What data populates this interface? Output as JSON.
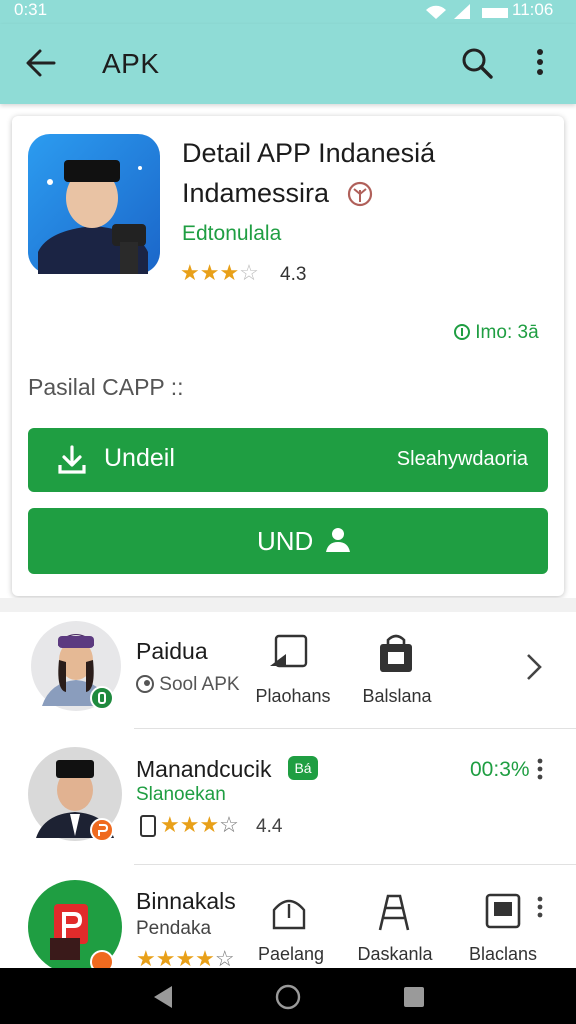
{
  "status_bar": {
    "time_left": "0:31",
    "time_right": "11:06"
  },
  "app_bar": {
    "title": "APK"
  },
  "app": {
    "title_line1": "Detail APP Indanesiá",
    "title_line2": "Indamessira",
    "developer": "Edtonulala",
    "rating": "4.3",
    "stars": "★★★",
    "info_badge": "Imo: 3ā",
    "section_label": "Pasilal CAPP ::",
    "download_button": {
      "label": "Undeil",
      "right_label": "Sleahywdaoria"
    },
    "second_button": {
      "label": "UND"
    }
  },
  "list": [
    {
      "name": "Paidua",
      "sub": "Sool APK",
      "features": [
        "Plaohans",
        "Balslana"
      ]
    },
    {
      "name": "Manandcucik",
      "badge": "Bá",
      "developer": "Slanoekan",
      "stars": "★★★",
      "rating": "4.4",
      "percent": "00:3%"
    },
    {
      "name": "Binnakals",
      "developer": "Pendaka",
      "stars": "★★★★",
      "features": [
        "Paelang",
        "Daskanla",
        "Blaclans"
      ]
    }
  ],
  "colors": {
    "accent": "#1f9e42",
    "header": "#8fdcd6",
    "star": "#e8a019"
  }
}
